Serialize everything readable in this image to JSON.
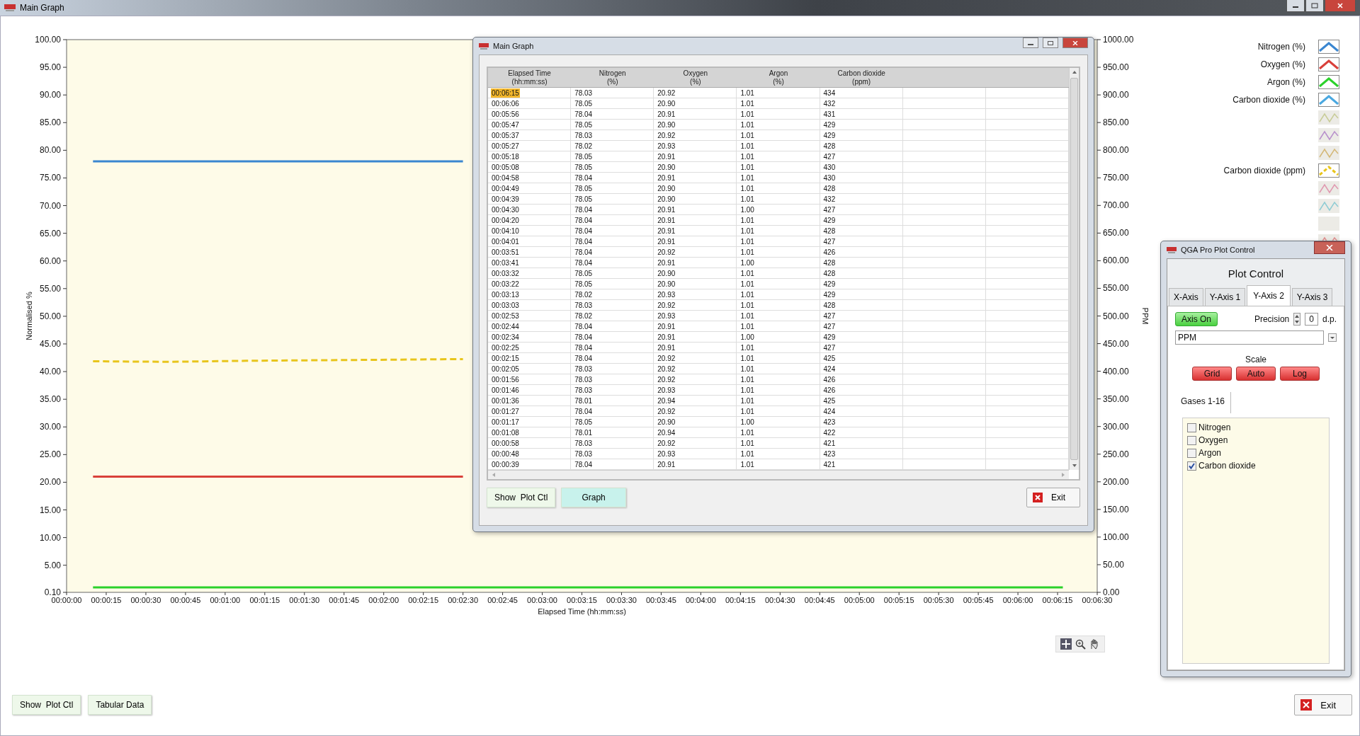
{
  "window": {
    "title": "Main Graph"
  },
  "chart": {
    "chart_data": {
      "type": "line",
      "xlabel": "Elapsed Time (hh:mm:ss)",
      "ylabel": "Normalised %",
      "y2label": "PPM",
      "xlim": [
        0,
        390
      ],
      "ylim": [
        0.1,
        100
      ],
      "y2lim": [
        0,
        1000
      ],
      "xticks": [
        {
          "value": 0,
          "label": "00:00:00"
        },
        {
          "value": 15,
          "label": "00:00:15"
        },
        {
          "value": 30,
          "label": "00:00:30"
        },
        {
          "value": 45,
          "label": "00:00:45"
        },
        {
          "value": 60,
          "label": "00:01:00"
        },
        {
          "value": 75,
          "label": "00:01:15"
        },
        {
          "value": 90,
          "label": "00:01:30"
        },
        {
          "value": 105,
          "label": "00:01:45"
        },
        {
          "value": 120,
          "label": "00:02:00"
        },
        {
          "value": 135,
          "label": "00:02:15"
        },
        {
          "value": 150,
          "label": "00:02:30"
        },
        {
          "value": 165,
          "label": "00:02:45"
        },
        {
          "value": 180,
          "label": "00:03:00"
        },
        {
          "value": 195,
          "label": "00:03:15"
        },
        {
          "value": 210,
          "label": "00:03:30"
        },
        {
          "value": 225,
          "label": "00:03:45"
        },
        {
          "value": 240,
          "label": "00:04:00"
        },
        {
          "value": 255,
          "label": "00:04:15"
        },
        {
          "value": 270,
          "label": "00:04:30"
        },
        {
          "value": 285,
          "label": "00:04:45"
        },
        {
          "value": 300,
          "label": "00:05:00"
        },
        {
          "value": 315,
          "label": "00:05:15"
        },
        {
          "value": 330,
          "label": "00:05:30"
        },
        {
          "value": 345,
          "label": "00:05:45"
        },
        {
          "value": 360,
          "label": "00:06:00"
        },
        {
          "value": 375,
          "label": "00:06:15"
        },
        {
          "value": 390,
          "label": "00:06:30"
        }
      ],
      "yticks": [
        {
          "value": 0.1,
          "label": "0.10"
        },
        {
          "value": 5,
          "label": "5.00"
        },
        {
          "value": 10,
          "label": "10.00"
        },
        {
          "value": 15,
          "label": "15.00"
        },
        {
          "value": 20,
          "label": "20.00"
        },
        {
          "value": 25,
          "label": "25.00"
        },
        {
          "value": 30,
          "label": "30.00"
        },
        {
          "value": 35,
          "label": "35.00"
        },
        {
          "value": 40,
          "label": "40.00"
        },
        {
          "value": 45,
          "label": "45.00"
        },
        {
          "value": 50,
          "label": "50.00"
        },
        {
          "value": 55,
          "label": "55.00"
        },
        {
          "value": 60,
          "label": "60.00"
        },
        {
          "value": 65,
          "label": "65.00"
        },
        {
          "value": 70,
          "label": "70.00"
        },
        {
          "value": 75,
          "label": "75.00"
        },
        {
          "value": 80,
          "label": "80.00"
        },
        {
          "value": 85,
          "label": "85.00"
        },
        {
          "value": 90,
          "label": "90.00"
        },
        {
          "value": 95,
          "label": "95.00"
        },
        {
          "value": 100,
          "label": "100.00"
        }
      ],
      "y2ticks": [
        {
          "value": 0,
          "label": "0.00"
        },
        {
          "value": 50,
          "label": "50.00"
        },
        {
          "value": 100,
          "label": "100.00"
        },
        {
          "value": 150,
          "label": "150.00"
        },
        {
          "value": 200,
          "label": "200.00"
        },
        {
          "value": 250,
          "label": "250.00"
        },
        {
          "value": 300,
          "label": "300.00"
        },
        {
          "value": 350,
          "label": "350.00"
        },
        {
          "value": 400,
          "label": "400.00"
        },
        {
          "value": 450,
          "label": "450.00"
        },
        {
          "value": 500,
          "label": "500.00"
        },
        {
          "value": 550,
          "label": "550.00"
        },
        {
          "value": 600,
          "label": "600.00"
        },
        {
          "value": 650,
          "label": "650.00"
        },
        {
          "value": 700,
          "label": "700.00"
        },
        {
          "value": 750,
          "label": "750.00"
        },
        {
          "value": 800,
          "label": "800.00"
        },
        {
          "value": 850,
          "label": "850.00"
        },
        {
          "value": 900,
          "label": "900.00"
        },
        {
          "value": 950,
          "label": "950.00"
        },
        {
          "value": 1000,
          "label": "1000.00"
        }
      ],
      "x": [
        10,
        39,
        68,
        97,
        126,
        150,
        184,
        213,
        242,
        271,
        300,
        329,
        358,
        377
      ],
      "series": [
        {
          "name": "Nitrogen (%)",
          "color": "#3a86d0",
          "values": [
            78,
            78,
            78,
            78,
            78,
            78,
            null,
            null,
            null,
            null,
            null,
            null,
            null,
            null
          ]
        },
        {
          "name": "Oxygen (%)",
          "color": "#d9403a",
          "values": [
            21,
            21,
            21,
            21,
            21,
            21,
            null,
            null,
            null,
            null,
            null,
            null,
            null,
            null
          ]
        },
        {
          "name": "Argon (%)",
          "color": "#2bd12b",
          "values": [
            1,
            1,
            1,
            1,
            1,
            1,
            1,
            1,
            1,
            1,
            1,
            1,
            1,
            1
          ]
        },
        {
          "name": "Carbon dioxide (ppm)",
          "color": "#e8c51c",
          "axis": "y2",
          "line_style": "dashed",
          "values": [
            418,
            417,
            419,
            420,
            421,
            422,
            null,
            null,
            null,
            null,
            null,
            null,
            null,
            null
          ]
        }
      ]
    }
  },
  "legend": [
    {
      "kind": "series"
    },
    {
      "kind": "series"
    },
    {
      "kind": "series"
    },
    {
      "kind": "item",
      "label": "Carbon dioxide (%)",
      "color": "#4aa8e0"
    },
    {
      "kind": "inactive",
      "color": "#c8cc98"
    },
    {
      "kind": "inactive",
      "color": "#b890cc"
    },
    {
      "kind": "inactive",
      "color": "#d4b878"
    },
    {
      "kind": "series"
    },
    {
      "kind": "inactive",
      "color": "#e098b0"
    },
    {
      "kind": "inactive",
      "color": "#90ccd4"
    },
    {
      "kind": "blank"
    },
    {
      "kind": "inactive",
      "color": "#e09090"
    }
  ],
  "bottom_buttons": [
    {
      "label": "Show  Plot Ctl"
    },
    {
      "label": "Tabular Data"
    }
  ],
  "exit_button": {
    "label": "Exit"
  },
  "table_window": {
    "title": "Main Graph",
    "columns": [
      {
        "title": "Elapsed Time",
        "unit": "(hh:mm:ss)"
      },
      {
        "title": "Nitrogen",
        "unit": "(%)"
      },
      {
        "title": "Oxygen",
        "unit": "(%)"
      },
      {
        "title": "Argon",
        "unit": "(%)"
      },
      {
        "title": "Carbon dioxide",
        "unit": "(ppm)"
      }
    ],
    "rows": [
      {
        "selected": true,
        "cells": [
          "00:06:15",
          "78.03",
          "20.92",
          "1.01",
          "434"
        ]
      },
      {
        "selected": false,
        "cells": [
          "00:06:06",
          "78.05",
          "20.90",
          "1.01",
          "432"
        ]
      },
      {
        "selected": false,
        "cells": [
          "00:05:56",
          "78.04",
          "20.91",
          "1.01",
          "431"
        ]
      },
      {
        "selected": false,
        "cells": [
          "00:05:47",
          "78.05",
          "20.90",
          "1.01",
          "429"
        ]
      },
      {
        "selected": false,
        "cells": [
          "00:05:37",
          "78.03",
          "20.92",
          "1.01",
          "429"
        ]
      },
      {
        "selected": false,
        "cells": [
          "00:05:27",
          "78.02",
          "20.93",
          "1.01",
          "428"
        ]
      },
      {
        "selected": false,
        "cells": [
          "00:05:18",
          "78.05",
          "20.91",
          "1.01",
          "427"
        ]
      },
      {
        "selected": false,
        "cells": [
          "00:05:08",
          "78.05",
          "20.90",
          "1.01",
          "430"
        ]
      },
      {
        "selected": false,
        "cells": [
          "00:04:58",
          "78.04",
          "20.91",
          "1.01",
          "430"
        ]
      },
      {
        "selected": false,
        "cells": [
          "00:04:49",
          "78.05",
          "20.90",
          "1.01",
          "428"
        ]
      },
      {
        "selected": false,
        "cells": [
          "00:04:39",
          "78.05",
          "20.90",
          "1.01",
          "432"
        ]
      },
      {
        "selected": false,
        "cells": [
          "00:04:30",
          "78.04",
          "20.91",
          "1.00",
          "427"
        ]
      },
      {
        "selected": false,
        "cells": [
          "00:04:20",
          "78.04",
          "20.91",
          "1.01",
          "429"
        ]
      },
      {
        "selected": false,
        "cells": [
          "00:04:10",
          "78.04",
          "20.91",
          "1.01",
          "428"
        ]
      },
      {
        "selected": false,
        "cells": [
          "00:04:01",
          "78.04",
          "20.91",
          "1.01",
          "427"
        ]
      },
      {
        "selected": false,
        "cells": [
          "00:03:51",
          "78.04",
          "20.92",
          "1.01",
          "426"
        ]
      },
      {
        "selected": false,
        "cells": [
          "00:03:41",
          "78.04",
          "20.91",
          "1.00",
          "428"
        ]
      },
      {
        "selected": false,
        "cells": [
          "00:03:32",
          "78.05",
          "20.90",
          "1.01",
          "428"
        ]
      },
      {
        "selected": false,
        "cells": [
          "00:03:22",
          "78.05",
          "20.90",
          "1.01",
          "429"
        ]
      },
      {
        "selected": false,
        "cells": [
          "00:03:13",
          "78.02",
          "20.93",
          "1.01",
          "429"
        ]
      },
      {
        "selected": false,
        "cells": [
          "00:03:03",
          "78.03",
          "20.92",
          "1.01",
          "428"
        ]
      },
      {
        "selected": false,
        "cells": [
          "00:02:53",
          "78.02",
          "20.93",
          "1.01",
          "427"
        ]
      },
      {
        "selected": false,
        "cells": [
          "00:02:44",
          "78.04",
          "20.91",
          "1.01",
          "427"
        ]
      },
      {
        "selected": false,
        "cells": [
          "00:02:34",
          "78.04",
          "20.91",
          "1.00",
          "429"
        ]
      },
      {
        "selected": false,
        "cells": [
          "00:02:25",
          "78.04",
          "20.91",
          "1.01",
          "427"
        ]
      },
      {
        "selected": false,
        "cells": [
          "00:02:15",
          "78.04",
          "20.92",
          "1.01",
          "425"
        ]
      },
      {
        "selected": false,
        "cells": [
          "00:02:05",
          "78.03",
          "20.92",
          "1.01",
          "424"
        ]
      },
      {
        "selected": false,
        "cells": [
          "00:01:56",
          "78.03",
          "20.92",
          "1.01",
          "426"
        ]
      },
      {
        "selected": false,
        "cells": [
          "00:01:46",
          "78.03",
          "20.93",
          "1.01",
          "426"
        ]
      },
      {
        "selected": false,
        "cells": [
          "00:01:36",
          "78.01",
          "20.94",
          "1.01",
          "425"
        ]
      },
      {
        "selected": false,
        "cells": [
          "00:01:27",
          "78.04",
          "20.92",
          "1.01",
          "424"
        ]
      },
      {
        "selected": false,
        "cells": [
          "00:01:17",
          "78.05",
          "20.90",
          "1.00",
          "423"
        ]
      },
      {
        "selected": false,
        "cells": [
          "00:01:08",
          "78.01",
          "20.94",
          "1.01",
          "422"
        ]
      },
      {
        "selected": false,
        "cells": [
          "00:00:58",
          "78.03",
          "20.92",
          "1.01",
          "421"
        ]
      },
      {
        "selected": false,
        "cells": [
          "00:00:48",
          "78.03",
          "20.93",
          "1.01",
          "423"
        ]
      },
      {
        "selected": false,
        "cells": [
          "00:00:39",
          "78.04",
          "20.91",
          "1.01",
          "421"
        ]
      }
    ],
    "buttons": [
      {
        "label": "Show  Plot Ctl",
        "kind": "plain"
      },
      {
        "label": "Graph",
        "kind": "highlight"
      }
    ],
    "exit_button": {
      "label": "Exit"
    }
  },
  "plot_control": {
    "title": "QGA Pro Plot Control",
    "heading": "Plot Control",
    "tabs": [
      {
        "label": "X-Axis",
        "selected": false
      },
      {
        "label": "Y-Axis 1",
        "selected": false
      },
      {
        "label": "Y-Axis 2",
        "selected": true
      },
      {
        "label": "Y-Axis 3",
        "selected": false
      }
    ],
    "axis_toggle": {
      "label": "Axis On",
      "on": true
    },
    "precision": {
      "label": "Precision",
      "value": "0",
      "unit": "d.p."
    },
    "axis_name": {
      "value": "PPM"
    },
    "scale_label": "Scale",
    "toggles": [
      {
        "label": "Grid",
        "on": false
      },
      {
        "label": "Auto",
        "on": false
      },
      {
        "label": "Log",
        "on": false
      }
    ],
    "gases_tab": "Gases 1-16",
    "gases": [
      {
        "label": "Nitrogen",
        "checked": false
      },
      {
        "label": "Oxygen",
        "checked": false
      },
      {
        "label": "Argon",
        "checked": false
      },
      {
        "label": "Carbon dioxide",
        "checked": true
      }
    ]
  }
}
